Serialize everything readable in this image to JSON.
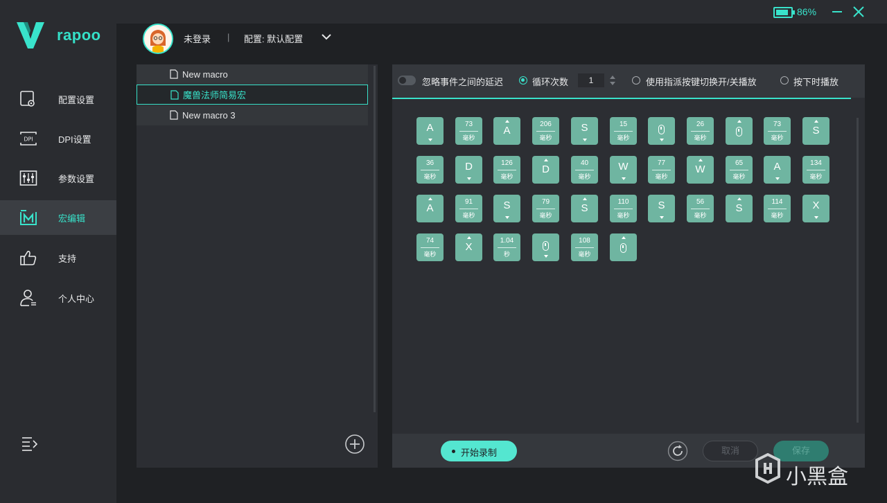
{
  "brand": {
    "name": "rapoo"
  },
  "sidebar": {
    "items": [
      {
        "label": "配置设置",
        "icon": "config-icon"
      },
      {
        "label": "DPI设置",
        "icon": "dpi-icon"
      },
      {
        "label": "参数设置",
        "icon": "sliders-icon"
      },
      {
        "label": "宏编辑",
        "icon": "macro-icon",
        "active": true
      },
      {
        "label": "支持",
        "icon": "thumbs-up-icon"
      },
      {
        "label": "个人中心",
        "icon": "user-icon"
      }
    ]
  },
  "titlebar": {
    "battery_percent": "86%",
    "battery_level": 0.86
  },
  "header": {
    "login": "未登录",
    "separator": "|",
    "config": "配置: 默认配置"
  },
  "macros": {
    "items": [
      {
        "label": "New macro"
      },
      {
        "label": "魔兽法师简易宏",
        "selected": true
      },
      {
        "label": "New macro 3"
      }
    ]
  },
  "options": {
    "ignore_delay": "忽略事件之间的延迟",
    "loop_count_label": "循环次数",
    "loop_count_value": "1",
    "toggle_by_key": "使用指派按键切换开/关播放",
    "play_while_pressed": "按下时播放"
  },
  "steps": [
    {
      "type": "key",
      "key": "A",
      "dir": "down"
    },
    {
      "type": "delay",
      "value": "73",
      "unit": "毫秒"
    },
    {
      "type": "key",
      "key": "A",
      "dir": "up"
    },
    {
      "type": "delay",
      "value": "206",
      "unit": "毫秒"
    },
    {
      "type": "key",
      "key": "S",
      "dir": "down"
    },
    {
      "type": "delay",
      "value": "15",
      "unit": "毫秒"
    },
    {
      "type": "mouse",
      "dir": "down"
    },
    {
      "type": "delay",
      "value": "26",
      "unit": "毫秒"
    },
    {
      "type": "mouse",
      "dir": "up"
    },
    {
      "type": "delay",
      "value": "73",
      "unit": "毫秒"
    },
    {
      "type": "key",
      "key": "S",
      "dir": "up"
    },
    {
      "type": "delay",
      "value": "36",
      "unit": "毫秒"
    },
    {
      "type": "key",
      "key": "D",
      "dir": "down"
    },
    {
      "type": "delay",
      "value": "126",
      "unit": "毫秒"
    },
    {
      "type": "key",
      "key": "D",
      "dir": "up"
    },
    {
      "type": "delay",
      "value": "40",
      "unit": "毫秒"
    },
    {
      "type": "key",
      "key": "W",
      "dir": "down"
    },
    {
      "type": "delay",
      "value": "77",
      "unit": "毫秒"
    },
    {
      "type": "key",
      "key": "W",
      "dir": "up"
    },
    {
      "type": "delay",
      "value": "65",
      "unit": "毫秒"
    },
    {
      "type": "key",
      "key": "A",
      "dir": "down"
    },
    {
      "type": "delay",
      "value": "134",
      "unit": "毫秒"
    },
    {
      "type": "key",
      "key": "A",
      "dir": "up"
    },
    {
      "type": "delay",
      "value": "91",
      "unit": "毫秒"
    },
    {
      "type": "key",
      "key": "S",
      "dir": "down"
    },
    {
      "type": "delay",
      "value": "79",
      "unit": "毫秒"
    },
    {
      "type": "key",
      "key": "S",
      "dir": "up"
    },
    {
      "type": "delay",
      "value": "110",
      "unit": "毫秒"
    },
    {
      "type": "key",
      "key": "S",
      "dir": "down"
    },
    {
      "type": "delay",
      "value": "56",
      "unit": "毫秒"
    },
    {
      "type": "key",
      "key": "S",
      "dir": "up"
    },
    {
      "type": "delay",
      "value": "114",
      "unit": "毫秒"
    },
    {
      "type": "key",
      "key": "X",
      "dir": "down"
    },
    {
      "type": "delay",
      "value": "74",
      "unit": "毫秒"
    },
    {
      "type": "key",
      "key": "X",
      "dir": "up"
    },
    {
      "type": "delay",
      "value": "1.04",
      "unit": "秒"
    },
    {
      "type": "mouse",
      "dir": "down"
    },
    {
      "type": "delay",
      "value": "108",
      "unit": "毫秒"
    },
    {
      "type": "mouse",
      "dir": "up"
    }
  ],
  "bottom": {
    "record": "开始录制",
    "cancel": "取消",
    "save": "保存"
  },
  "watermark": {
    "text": "小黑盒"
  },
  "colors": {
    "accent": "#39e3cb",
    "step_bg": "#6fb5a1",
    "sidebar_bg": "#2a2c30",
    "panel_bg": "#2c2e33"
  }
}
